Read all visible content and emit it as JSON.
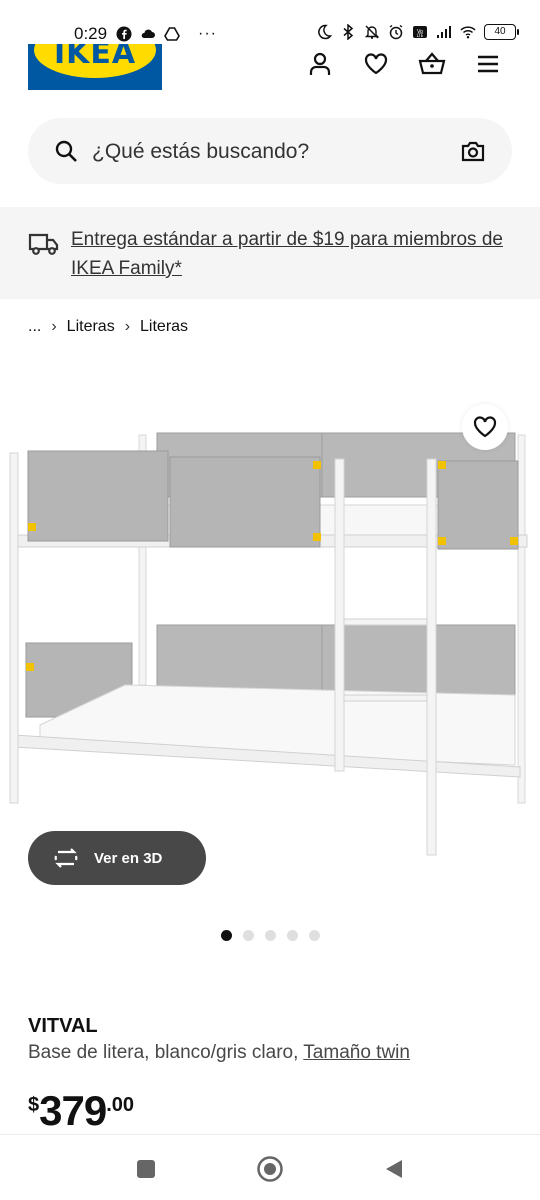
{
  "status_bar": {
    "time": "0:29",
    "battery": "40",
    "more": "···"
  },
  "header": {
    "logo_text": "IKEA",
    "icons": [
      "user-icon",
      "heart-icon",
      "basket-icon",
      "menu-icon"
    ]
  },
  "search": {
    "placeholder": "¿Qué estás buscando?"
  },
  "banner": {
    "text": "Entrega estándar a partir de $19 para miembros de IKEA Family*"
  },
  "breadcrumb": {
    "ellipsis": "...",
    "items": [
      "Literas",
      "Literas"
    ],
    "separator": "›"
  },
  "gallery": {
    "view3d_label": "Ver en 3D",
    "dots_total": 5,
    "active_dot": 1
  },
  "product": {
    "name": "VITVAL",
    "description": "Base de litera, blanco/gris claro, ",
    "size_link": "Tamaño twin",
    "price_currency": "$",
    "price_int": "379",
    "price_dec": ".00"
  },
  "colors": {
    "ikea_blue": "#0058a3",
    "ikea_yellow": "#ffdb00",
    "surface_gray": "#f5f5f5",
    "button_dark": "#484848"
  }
}
